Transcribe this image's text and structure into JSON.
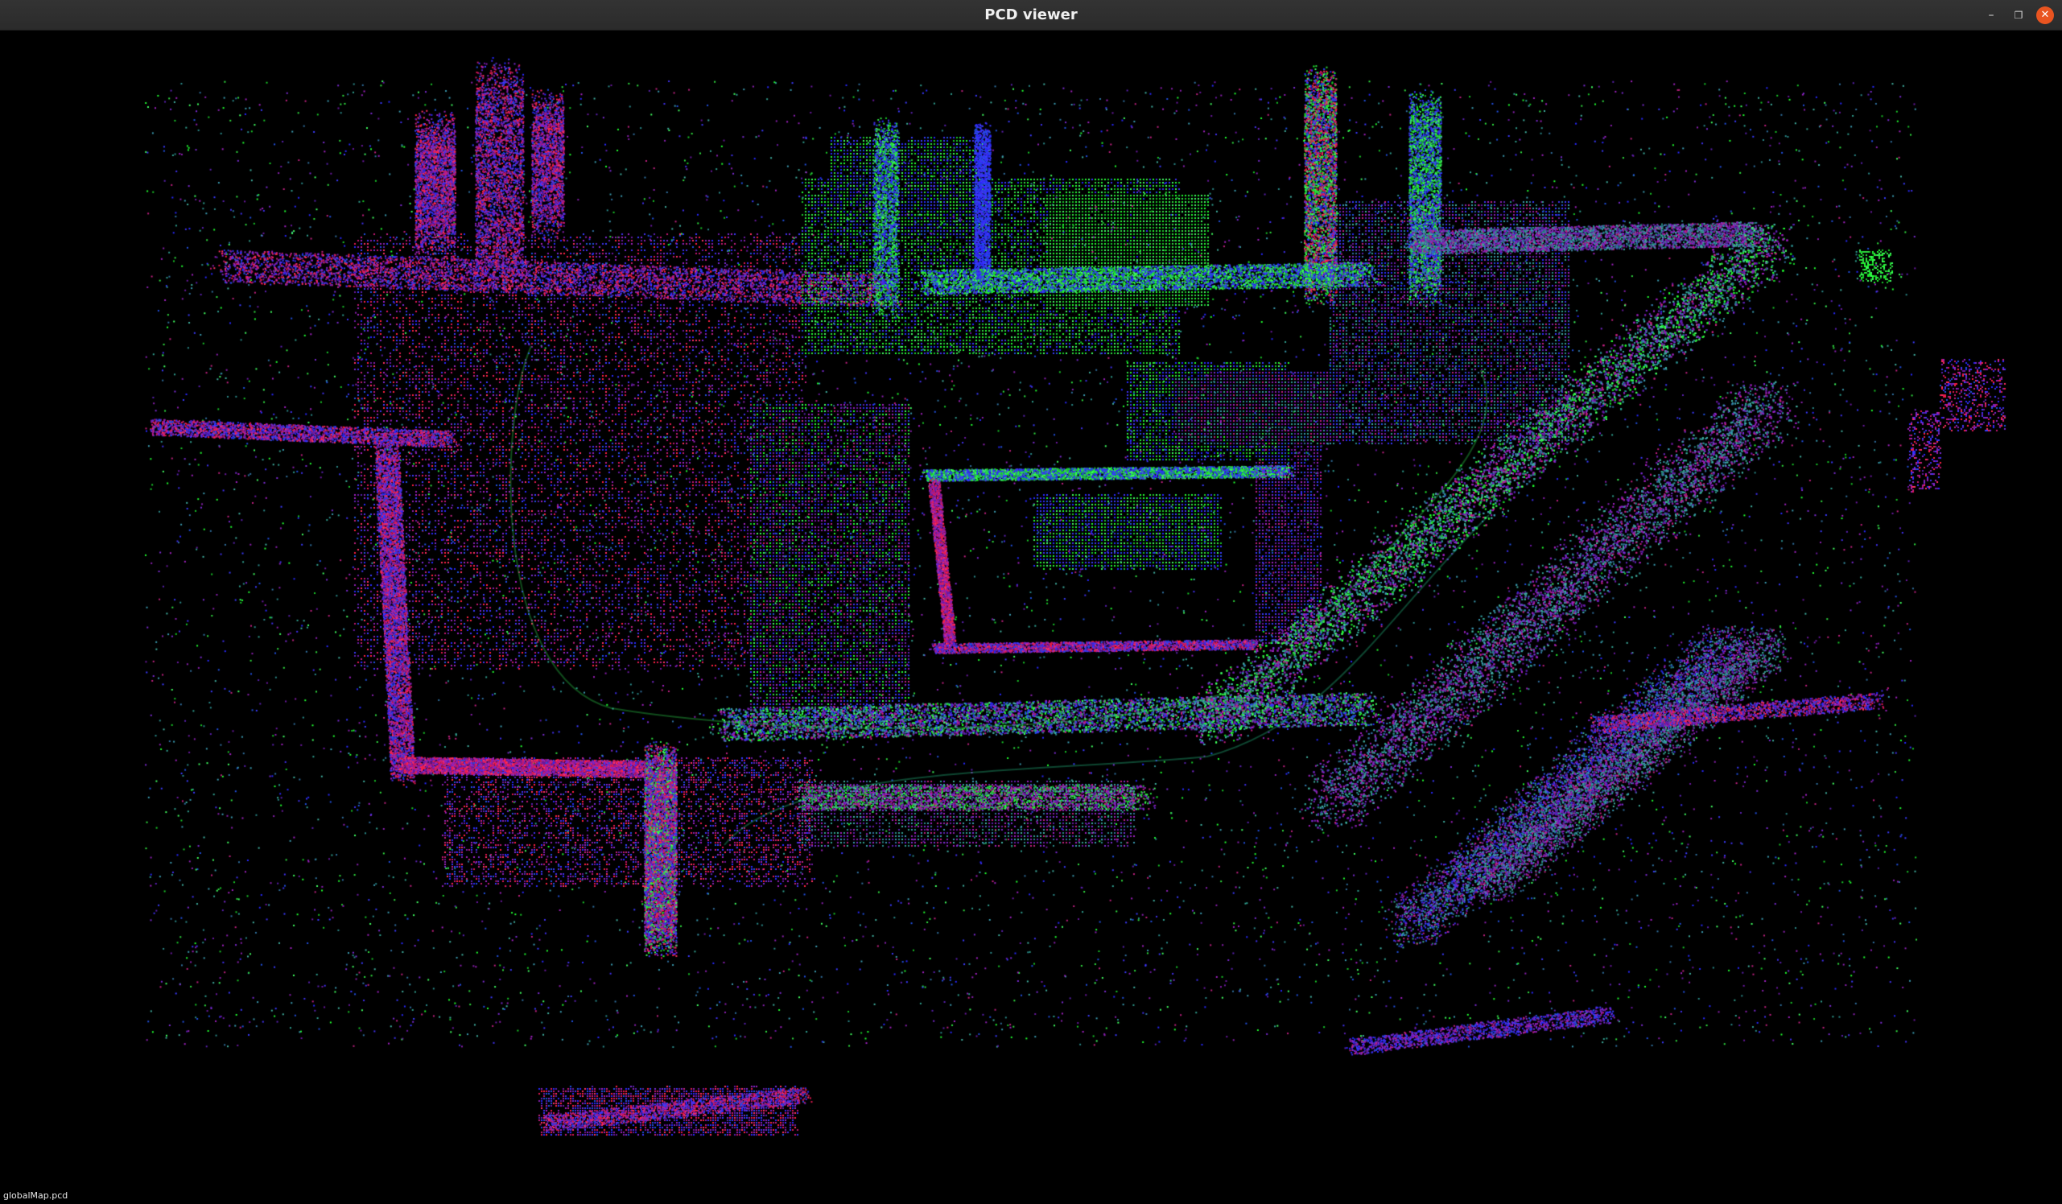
{
  "window": {
    "title": "PCD viewer",
    "controls": {
      "minimize_icon": "minimize-icon",
      "maximize_icon": "maximize-icon",
      "close_icon": "close-icon"
    }
  },
  "viewer": {
    "file_label": "globalMap.pcd",
    "background_color": "#000000",
    "point_colors": {
      "red": "#ff2030",
      "green": "#20ff30",
      "blue": "#3030ff",
      "magenta": "#a020c0",
      "teal": "#40a0a0"
    }
  }
}
